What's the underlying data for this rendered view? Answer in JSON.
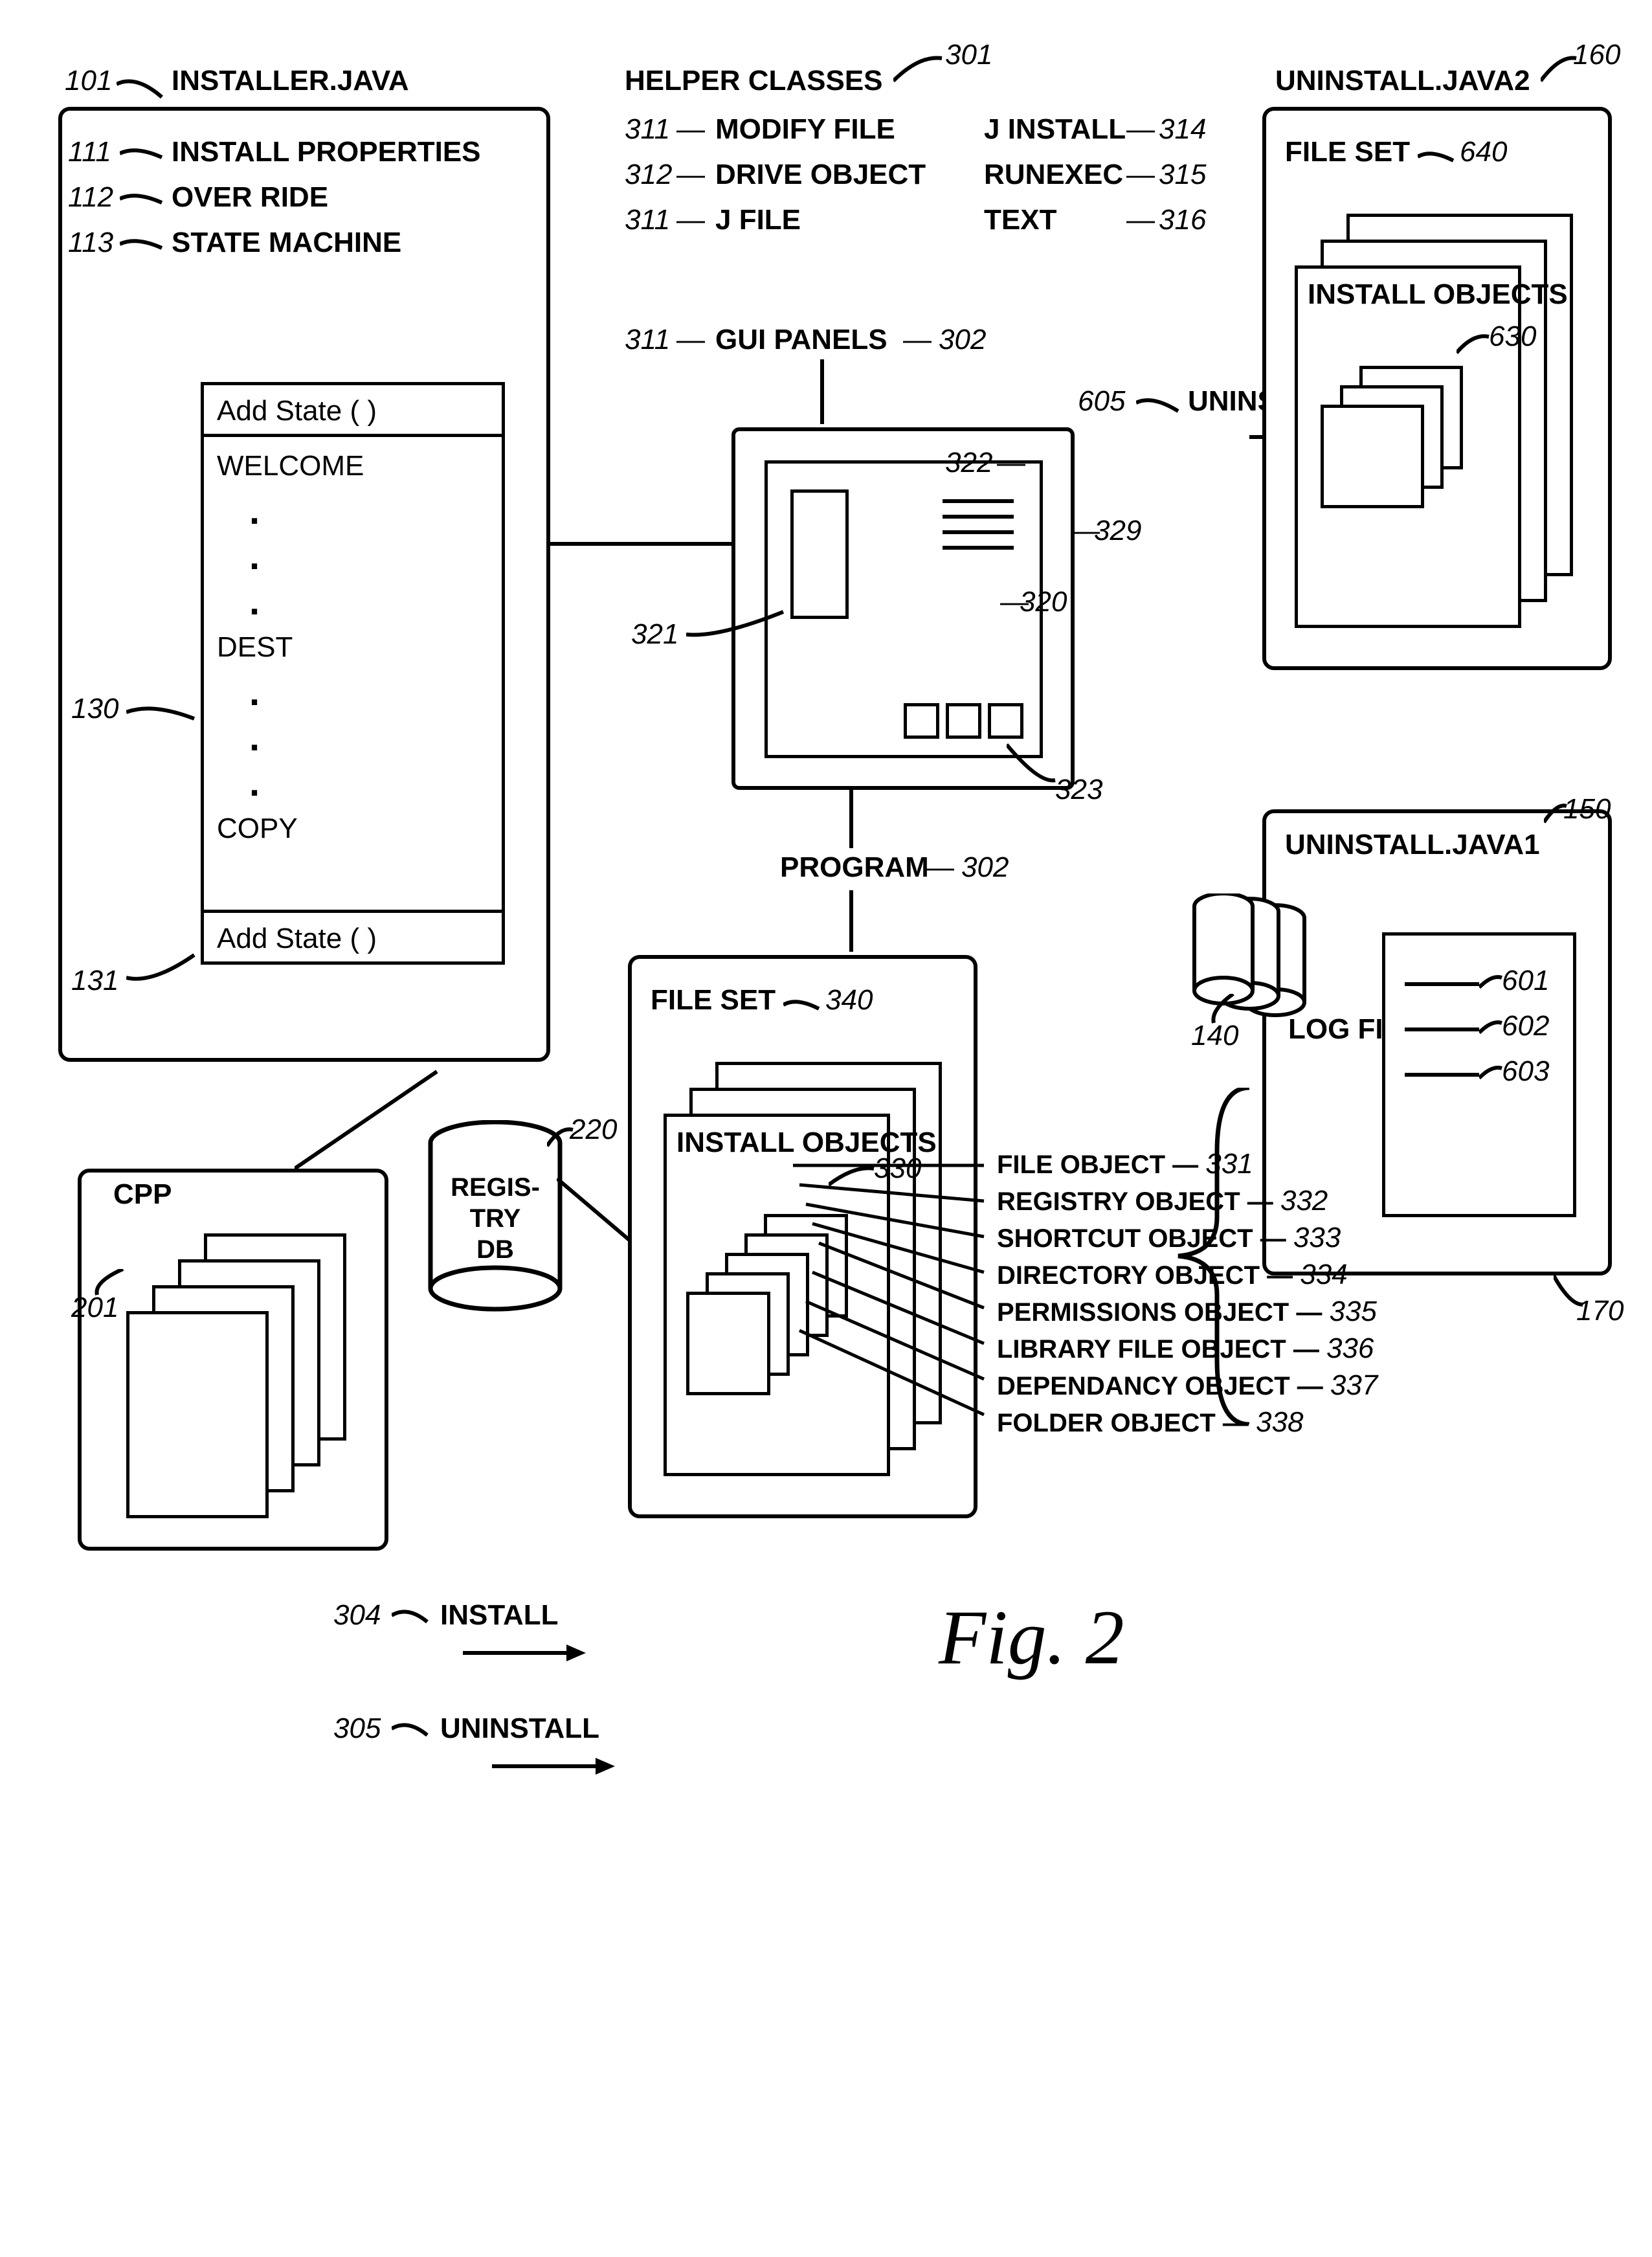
{
  "installer": {
    "title": "INSTALLER.JAVA",
    "num": "101",
    "props": [
      {
        "n": "111",
        "t": "INSTALL PROPERTIES"
      },
      {
        "n": "112",
        "t": "OVER RIDE"
      },
      {
        "n": "113",
        "t": "STATE MACHINE"
      }
    ],
    "sm": {
      "num": "130",
      "rows": [
        "Add State ( )",
        "WELCOME",
        ".",
        ".",
        ".",
        "DEST",
        ".",
        ".",
        ".",
        "COPY",
        "Add State ( )"
      ],
      "rownum": "131"
    }
  },
  "helper": {
    "title": "HELPER CLASSES",
    "num": "301",
    "left": [
      {
        "n": "311",
        "t": "MODIFY FILE"
      },
      {
        "n": "312",
        "t": "DRIVE OBJECT"
      },
      {
        "n": "311",
        "t": "J FILE"
      }
    ],
    "right": [
      {
        "t": "J INSTALL",
        "n": "314"
      },
      {
        "t": "RUNEXEC",
        "n": "315"
      },
      {
        "t": "TEXT",
        "n": "316"
      }
    ],
    "gui": {
      "n": "311",
      "t": "GUI PANELS",
      "rn": "302"
    },
    "panel": {
      "n329": "329",
      "n321": "321",
      "n322": "322",
      "n320": "320",
      "n323": "323"
    },
    "program": {
      "t": "PROGRAM",
      "n": "302"
    }
  },
  "uninstall": {
    "n": "605",
    "t": "UNINSTALL"
  },
  "uj2": {
    "title": "UNINSTALL.JAVA2",
    "num": "160",
    "fs": {
      "t": "FILE SET",
      "n": "640"
    },
    "io": {
      "t": "INSTALL OBJECTS",
      "n": "630"
    }
  },
  "uj1": {
    "title": "UNINSTALL.JAVA1",
    "num": "150",
    "boxnum": "170",
    "log": {
      "t": "LOG FILE",
      "n": "140"
    },
    "entries": [
      {
        "n": "601"
      },
      {
        "n": "602"
      },
      {
        "n": "603"
      }
    ]
  },
  "cpp": {
    "n": "201"
  },
  "registry": {
    "t": "REGIS-\nTRY\nDB",
    "n": "220"
  },
  "install": {
    "n": "304",
    "t": "INSTALL"
  },
  "uninst2": {
    "n": "305",
    "t": "UNINSTALL"
  },
  "fileset": {
    "fs": {
      "t": "FILE SET",
      "n": "340"
    },
    "io": {
      "t": "INSTALL OBJECTS",
      "n": "330"
    },
    "objs": [
      {
        "t": "FILE OBJECT",
        "n": "331"
      },
      {
        "t": "REGISTRY OBJECT",
        "n": "332"
      },
      {
        "t": "SHORTCUT OBJECT",
        "n": "333"
      },
      {
        "t": "DIRECTORY OBJECT",
        "n": "334"
      },
      {
        "t": "PERMISSIONS OBJECT",
        "n": "335"
      },
      {
        "t": "LIBRARY FILE OBJECT",
        "n": "336"
      },
      {
        "t": "DEPENDANCY OBJECT",
        "n": "337"
      },
      {
        "t": "FOLDER OBJECT",
        "n": "338"
      }
    ]
  },
  "fig": "Fig. 2"
}
